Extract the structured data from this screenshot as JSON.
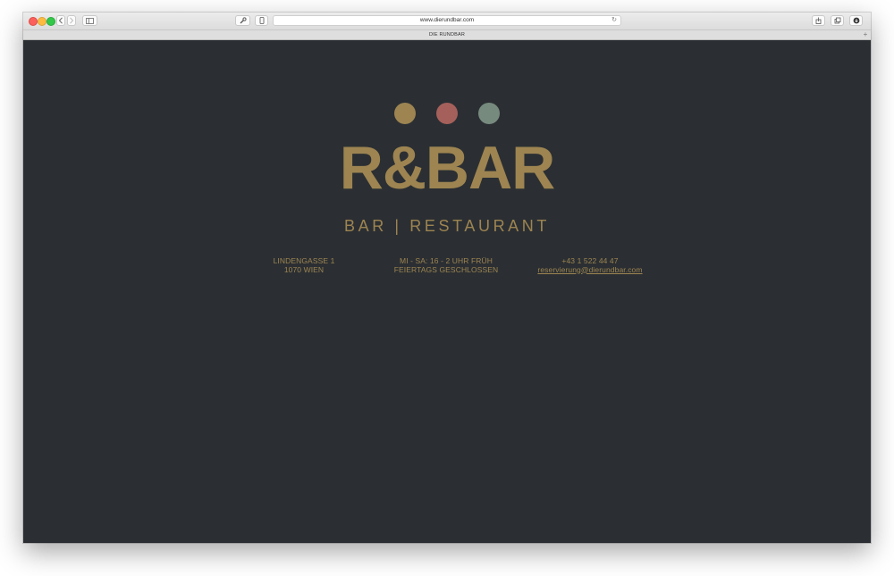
{
  "browser": {
    "url": "www.dierundbar.com",
    "tab_title": "DIE RUNDBAR",
    "new_tab_glyph": "+",
    "reload_glyph": "↻"
  },
  "site": {
    "dots": [
      {
        "color": "#9d8451"
      },
      {
        "color": "#a5605b"
      },
      {
        "color": "#778a7e"
      }
    ],
    "logo": "R&BAR",
    "tagline": "BAR | RESTAURANT",
    "gold": "#9d8451",
    "address": {
      "line1": "LINDENGASSE 1",
      "line2": "1070 WIEN"
    },
    "hours": {
      "line1": "MI - SA: 16 - 2 UHR FRÜH",
      "line2": "FEIERTAGS GESCHLOSSEN"
    },
    "contact": {
      "phone": "+43 1 522 44 47",
      "email": "reservierung@dierundbar.com"
    }
  },
  "icons": {
    "back": "chevron-left-icon",
    "forward": "chevron-right-icon",
    "sidebar": "sidebar-icon",
    "tools": "wrench-icon",
    "device": "device-icon",
    "share": "share-icon",
    "tabs": "tabs-icon",
    "download": "download-icon"
  }
}
